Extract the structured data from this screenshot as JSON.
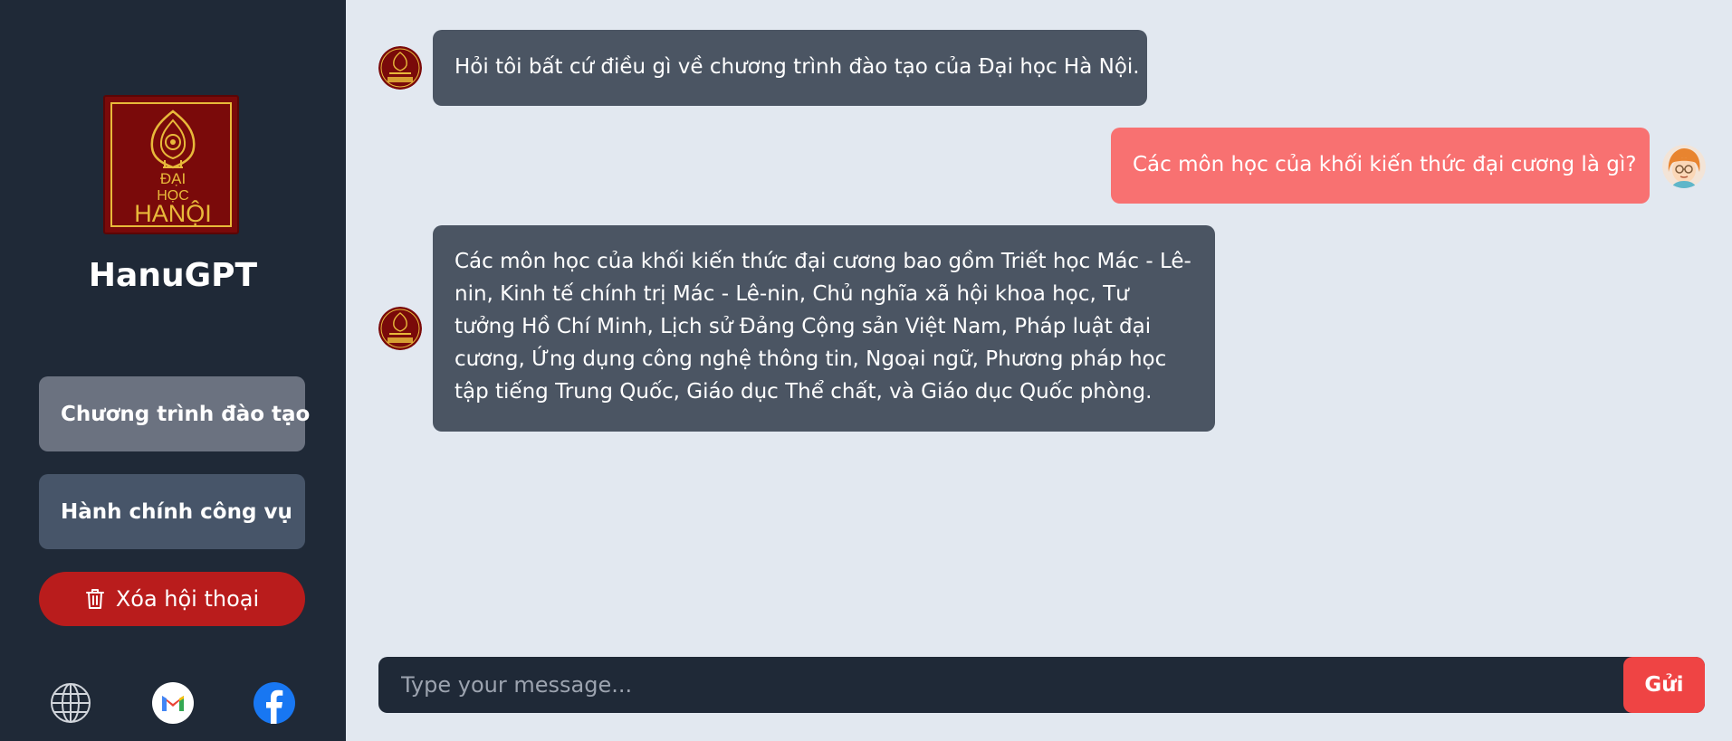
{
  "app": {
    "name": "HanuGPT",
    "logo_text": [
      "ĐẠI",
      "HỌC",
      "HANỘI"
    ]
  },
  "sidebar": {
    "buttons": [
      {
        "label": "Chương trình đào tạo"
      },
      {
        "label": "Hành chính công vụ"
      }
    ],
    "clear_label": "Xóa hội thoại",
    "social": [
      "globe-icon",
      "gmail-icon",
      "facebook-icon"
    ]
  },
  "chat": {
    "messages": [
      {
        "role": "bot",
        "text": "Hỏi tôi bất cứ điều gì về chương trình đào tạo của Đại học Hà Nội."
      },
      {
        "role": "user",
        "text": "Các môn học của khối kiến thức đại cương là gì?"
      },
      {
        "role": "bot",
        "text": "Các môn học của khối kiến thức đại cương bao gồm Triết học Mác - Lê-nin, Kinh tế chính trị Mác - Lê-nin, Chủ nghĩa xã hội khoa học, Tư tưởng Hồ Chí Minh, Lịch sử Đảng Cộng sản Việt Nam, Pháp luật đại cương, Ứng dụng công nghệ thông tin, Ngoại ngữ, Phương pháp học tập tiếng Trung Quốc, Giáo dục Thể chất, và Giáo dục Quốc phòng."
      }
    ]
  },
  "input": {
    "placeholder": "Type your message...",
    "value": "",
    "send_label": "Gửi"
  },
  "colors": {
    "sidebar_bg": "#1f2937",
    "main_bg": "#e2e8f0",
    "bot_bubble": "#4b5563",
    "user_bubble": "#f87171",
    "danger": "#b91c1c",
    "send": "#ef4444"
  }
}
